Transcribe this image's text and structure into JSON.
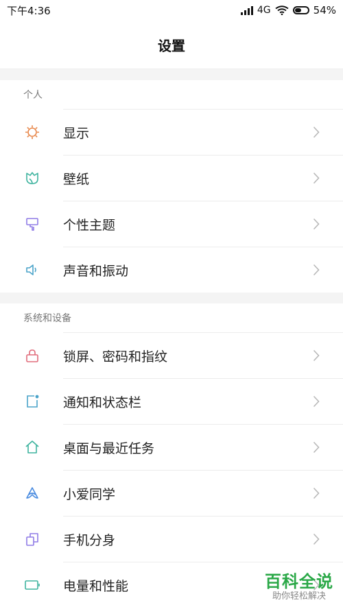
{
  "status_bar": {
    "time": "下午4:36",
    "network": "4G",
    "battery": "54%",
    "battery_level": 0.54
  },
  "header": {
    "title": "设置"
  },
  "sections": [
    {
      "header": "个人",
      "items": [
        {
          "label": "显示",
          "icon": "sun-icon",
          "color": "#e8874a"
        },
        {
          "label": "壁纸",
          "icon": "tulip-icon",
          "color": "#3db39e"
        },
        {
          "label": "个性主题",
          "icon": "paint-brush-icon",
          "color": "#8f7be6"
        },
        {
          "label": "声音和振动",
          "icon": "speaker-icon",
          "color": "#4aa3c9"
        }
      ]
    },
    {
      "header": "系统和设备",
      "items": [
        {
          "label": "锁屏、密码和指纹",
          "icon": "lock-icon",
          "color": "#e06b7a"
        },
        {
          "label": "通知和状态栏",
          "icon": "notification-icon",
          "color": "#4aa3c9"
        },
        {
          "label": "桌面与最近任务",
          "icon": "home-icon",
          "color": "#3db39e"
        },
        {
          "label": "小爱同学",
          "icon": "xiaoai-icon",
          "color": "#4a8ce0"
        },
        {
          "label": "手机分身",
          "icon": "dual-phone-icon",
          "color": "#8f7be6"
        },
        {
          "label": "电量和性能",
          "icon": "battery-icon",
          "color": "#3db39e"
        }
      ]
    }
  ],
  "watermark": {
    "title": "百科全说",
    "subtitle": "助你轻松解决"
  }
}
